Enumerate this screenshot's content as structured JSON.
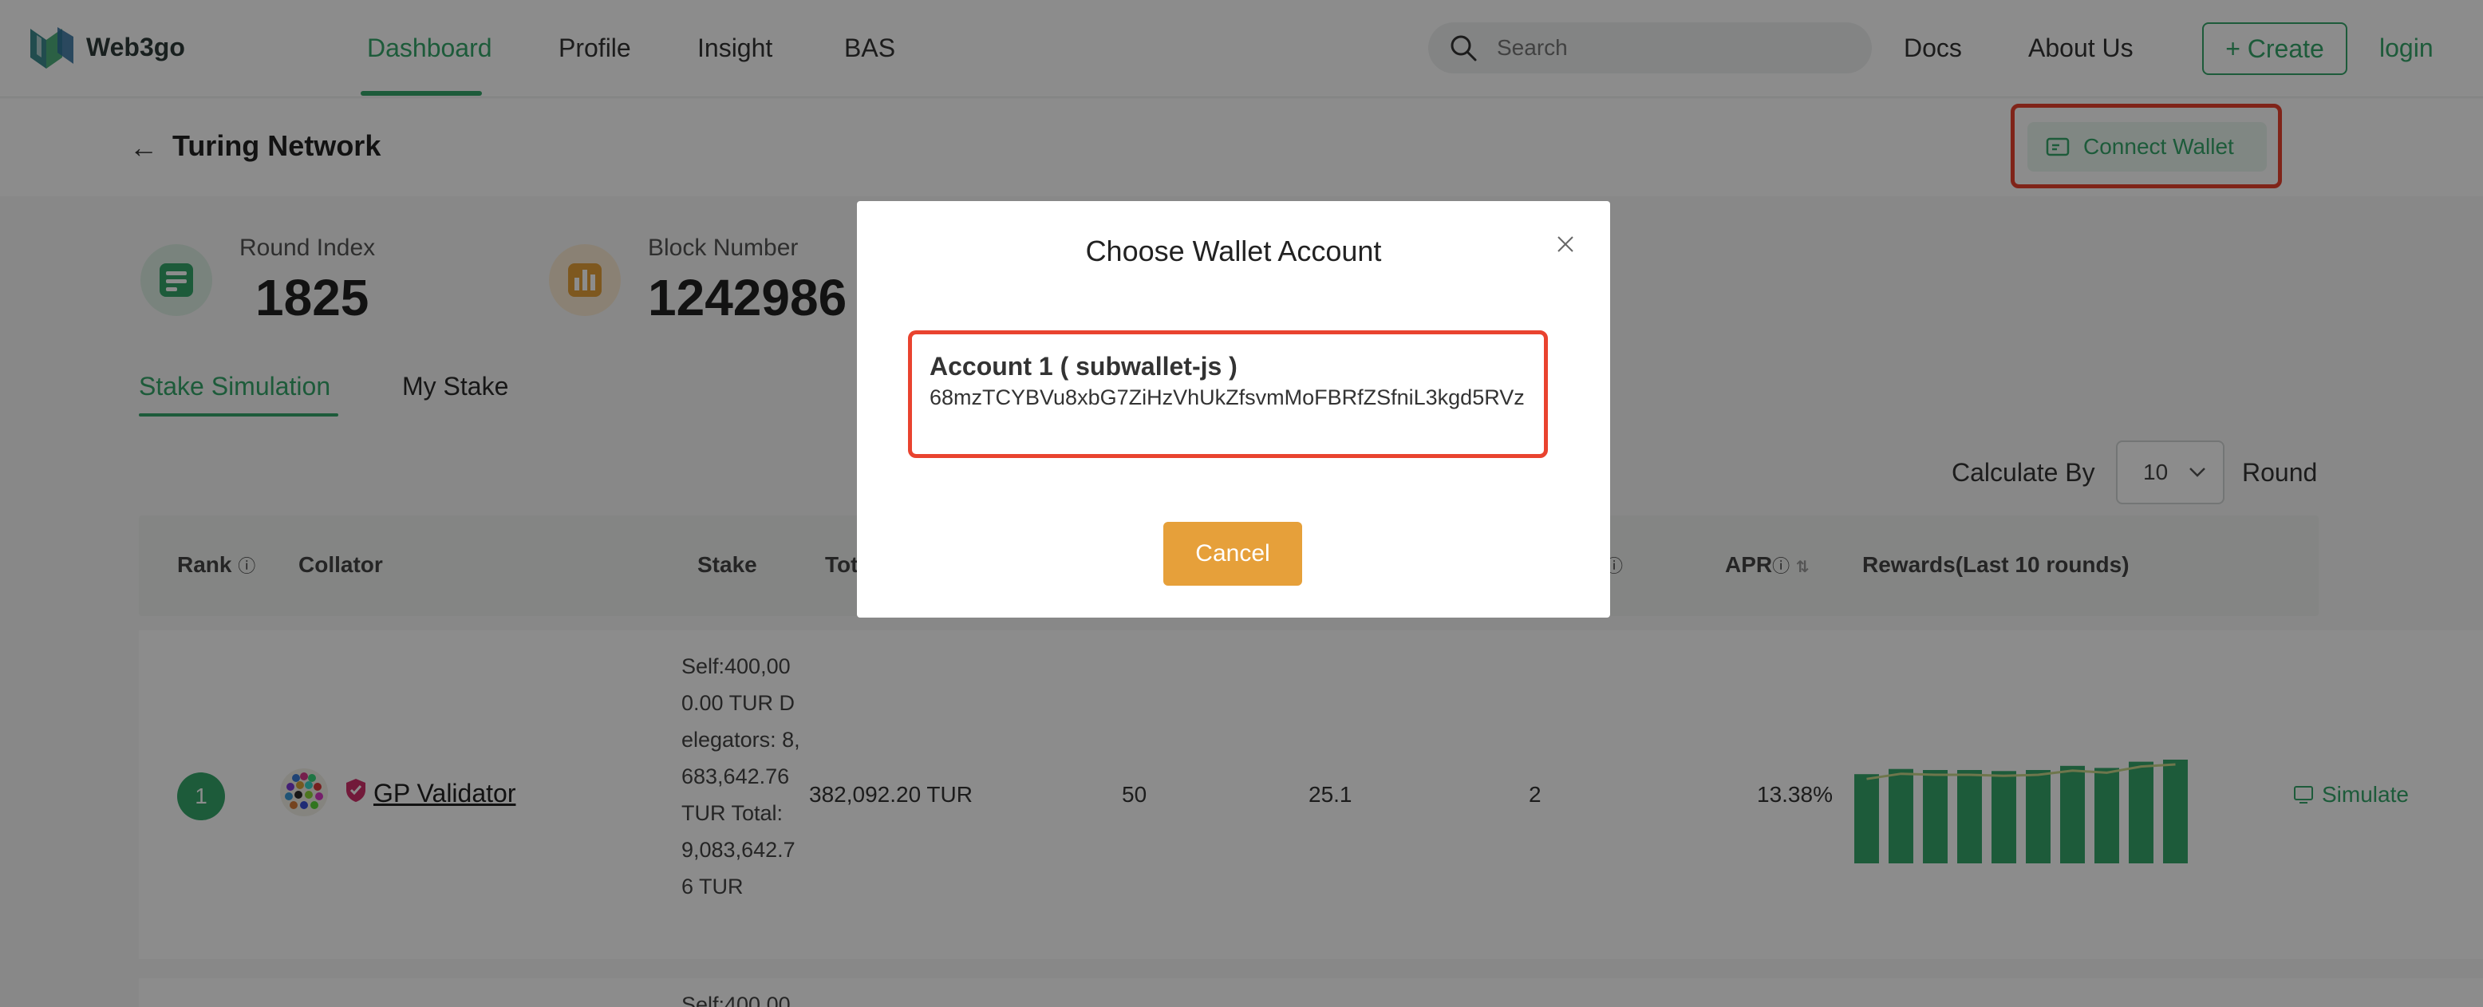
{
  "nav": {
    "logo_text": "Web3go",
    "links": [
      "Dashboard",
      "Profile",
      "Insight",
      "BAS"
    ],
    "search_placeholder": "Search",
    "docs": "Docs",
    "about": "About Us",
    "create": "+ Create",
    "login": "login",
    "accent_color": "#35a66b"
  },
  "subheader": {
    "back_icon": "arrow-left-icon",
    "title": "Turing Network",
    "connect_label": "Connect Wallet"
  },
  "stats": {
    "round_index_label": "Round Index",
    "round_index_value": "1825",
    "block_number_label": "Block Number",
    "block_number_value": "1242986"
  },
  "tabs": [
    "Stake Simulation",
    "My Stake"
  ],
  "calculate": {
    "label": "Calculate By",
    "value": "10",
    "suffix": "Round"
  },
  "table": {
    "headers": {
      "rank": "Rank",
      "collator": "Collator",
      "stake": "Stake",
      "total": "Tot",
      "apr": "APR",
      "rewards": "Rewards(Last 10 rounds)"
    },
    "rows": [
      {
        "rank": "1",
        "name": "GP Validator",
        "stake_detail": "Self:400,000.00 TUR Delegators: 8,683,642.76 TUR Total: 9,083,642.76 TUR",
        "total": "382,092.20 TUR",
        "col1": "50",
        "col2": "25.1",
        "col3": "2",
        "apr": "13.38%",
        "rewards": [
          0.86,
          0.91,
          0.9,
          0.9,
          0.89,
          0.9,
          0.94,
          0.92,
          0.98,
          1.0
        ],
        "action": "Simulate"
      }
    ],
    "next_row_partial": "Self:400,00"
  },
  "modal": {
    "title": "Choose Wallet Account",
    "account_name": "Account 1 ( subwallet-js )",
    "account_address": "68mzTCYBVu8xbG7ZiHzVhUkZfsvmMoFBRfZSfniL3kgd5RVz",
    "cancel": "Cancel",
    "cancel_color": "#e6a03a",
    "highlight_color": "#e9432f"
  }
}
